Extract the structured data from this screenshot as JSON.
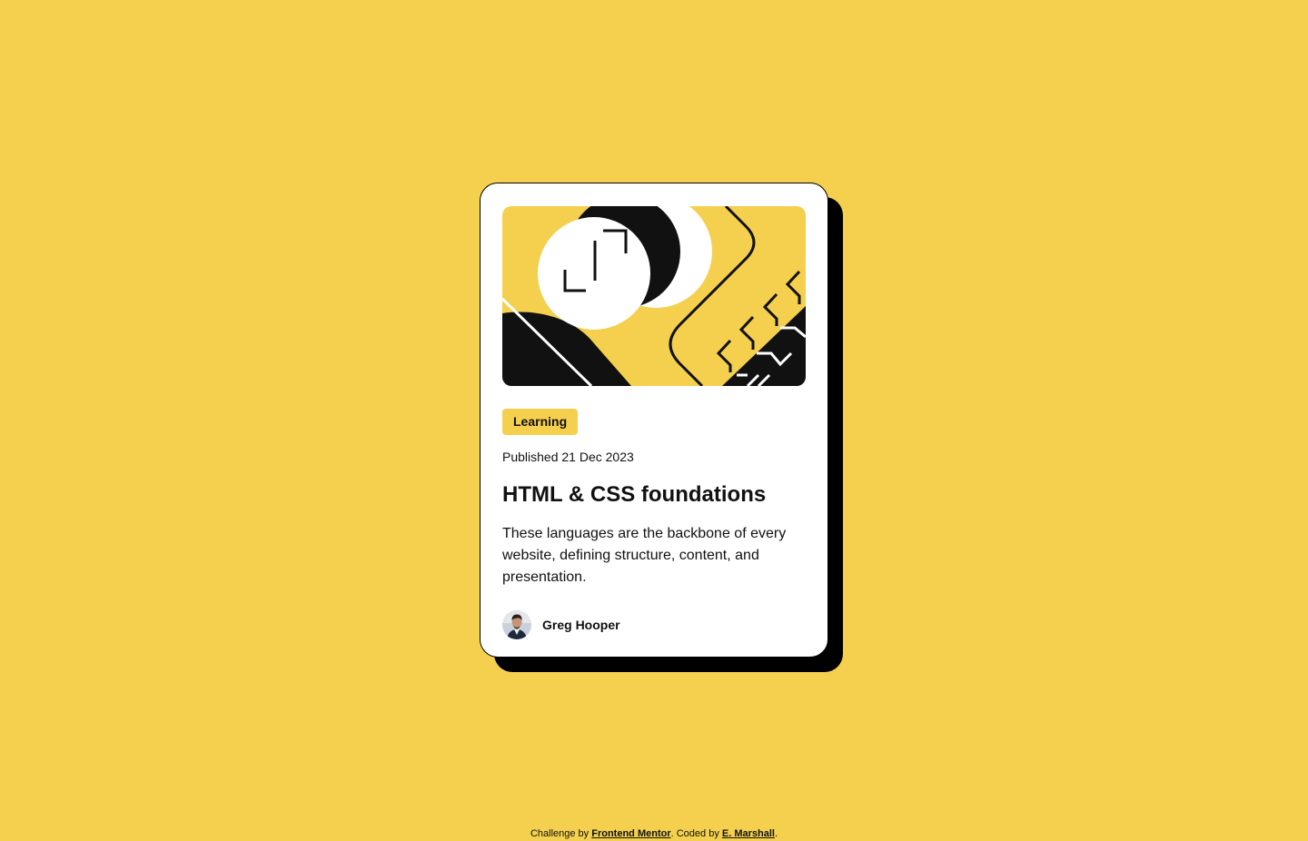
{
  "card": {
    "hero_image": "illustration-article",
    "tag": "Learning",
    "published": "Published 21 Dec 2023",
    "title": "HTML & CSS foundations",
    "description": "These languages are the backbone of every website, defining structure, content, and presentation.",
    "author": {
      "avatar": "image-avatar",
      "name": "Greg Hooper"
    }
  },
  "footer": {
    "prefix": "Challenge by ",
    "link1": "Frontend Mentor",
    "middle": ". Coded by ",
    "link2": "E. Marshall",
    "suffix": "."
  },
  "colors": {
    "background": "#F4D04E",
    "card": "#FFFFFF",
    "ink": "#111111",
    "shadow": "#000000"
  }
}
